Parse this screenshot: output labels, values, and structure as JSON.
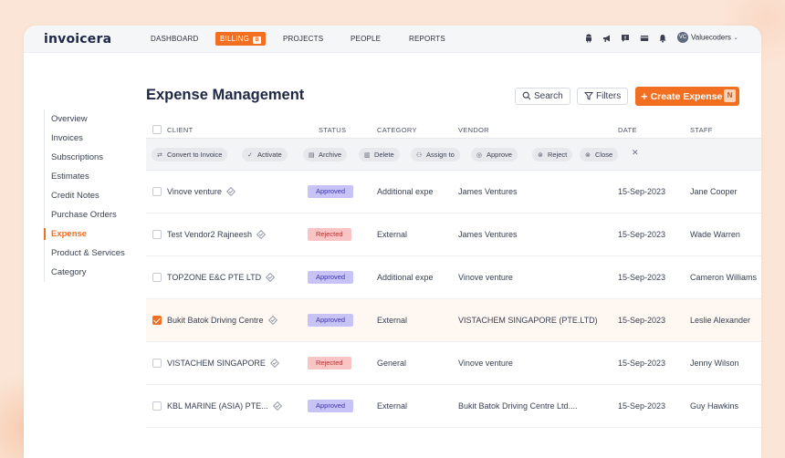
{
  "app": {
    "logo": "invoicera"
  },
  "nav": {
    "items": [
      {
        "label": "DASHBOARD"
      },
      {
        "label": "BILLING",
        "badge": "B"
      },
      {
        "label": "PROJECTS"
      },
      {
        "label": "PEOPLE"
      },
      {
        "label": "REPORTS"
      }
    ],
    "icons": [
      "android-icon",
      "megaphone-icon",
      "help-icon",
      "card-icon",
      "bell-icon"
    ],
    "user": {
      "initials": "VC",
      "name": "Valuecoders"
    }
  },
  "sidebar": {
    "items": [
      {
        "label": "Overview"
      },
      {
        "label": "Invoices"
      },
      {
        "label": "Subscriptions"
      },
      {
        "label": "Estimates"
      },
      {
        "label": "Credit Notes"
      },
      {
        "label": "Purchase Orders"
      },
      {
        "label": "Expense",
        "active": true
      },
      {
        "label": "Product & Services"
      },
      {
        "label": "Category"
      }
    ]
  },
  "page": {
    "title": "Expense Management",
    "search_label": "Search",
    "filters_label": "Filters",
    "create_label": "Create Expense",
    "create_shortcut": "N"
  },
  "table": {
    "columns": [
      "CLIENT",
      "STATUS",
      "CATEGORY",
      "VENDOR",
      "DATE",
      "STAFF"
    ],
    "actions": [
      "Convert to Invoice",
      "Activate",
      "Archive",
      "Delete",
      "Assign to",
      "Approve",
      "Reject",
      "Close"
    ],
    "rows": [
      {
        "client": "Vinove venture",
        "status": "Approved",
        "category": "Additional expe",
        "vendor": "James Ventures",
        "date": "15-Sep-2023",
        "staff": "Jane Cooper",
        "checked": false
      },
      {
        "client": "Test Vendor2 Rajneesh",
        "status": "Rejected",
        "category": "External",
        "vendor": "James Ventures",
        "date": "15-Sep-2023",
        "staff": "Wade Warren",
        "checked": false
      },
      {
        "client": "TOPZONE E&C PTE LTD",
        "status": "Approved",
        "category": "Additional expe",
        "vendor": "Vinove venture",
        "date": "15-Sep-2023",
        "staff": "Cameron Williams",
        "checked": false
      },
      {
        "client": "Bukit Batok Driving Centre",
        "status": "Approved",
        "category": "External",
        "vendor": "VISTACHEM SINGAPORE (PTE.LTD)",
        "date": "15-Sep-2023",
        "staff": "Leslie Alexander",
        "checked": true
      },
      {
        "client": "VISTACHEM SINGAPORE",
        "status": "Rejected",
        "category": "General",
        "vendor": "Vinove venture",
        "date": "15-Sep-2023",
        "staff": "Jenny Wilson",
        "checked": false
      },
      {
        "client": "KBL MARINE (ASIA) PTE...",
        "status": "Approved",
        "category": "External",
        "vendor": "Bukit Batok Driving Centre Ltd....",
        "date": "15-Sep-2023",
        "staff": "Guy Hawkins",
        "checked": false
      }
    ]
  },
  "colors": {
    "accent": "#f26f21",
    "approved_bg": "#c7c3f7",
    "rejected_bg": "#f8c4c4"
  }
}
